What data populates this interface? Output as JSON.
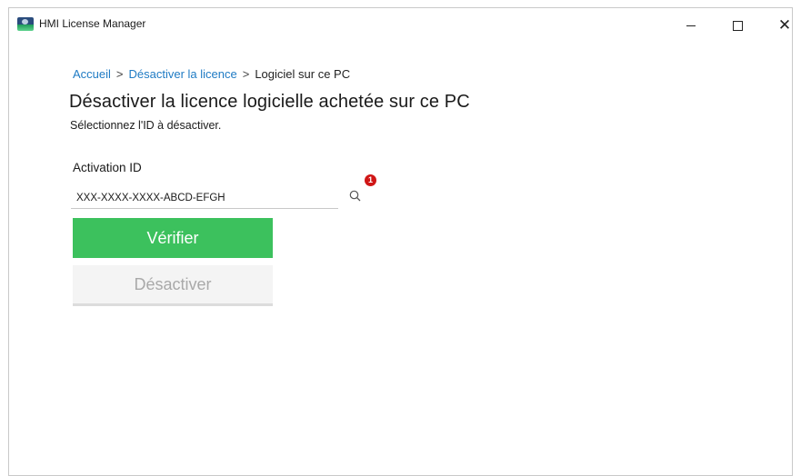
{
  "window": {
    "title": "HMI License Manager",
    "controls": {
      "minimize": "—",
      "maximize": "☐",
      "close": "✕"
    }
  },
  "breadcrumb": {
    "home": "Accueil",
    "separator": ">",
    "deactivate": "Désactiver la licence",
    "current": "Logiciel sur ce PC"
  },
  "page": {
    "heading": "Désactiver la licence logicielle achetée sur ce PC",
    "subheading": "Sélectionnez l'ID à désactiver."
  },
  "form": {
    "label": "Activation ID",
    "value": "XXX-XXXX-XXXX-ABCD-EFGH",
    "badge": "1",
    "search_icon": "search-icon"
  },
  "buttons": {
    "verify": "Vérifier",
    "deactivate": "Désactiver"
  },
  "colors": {
    "link": "#1f7bc4",
    "verify_bg": "#3cc15d",
    "badge": "#d01616",
    "disabled_text": "#a9a9a9"
  }
}
